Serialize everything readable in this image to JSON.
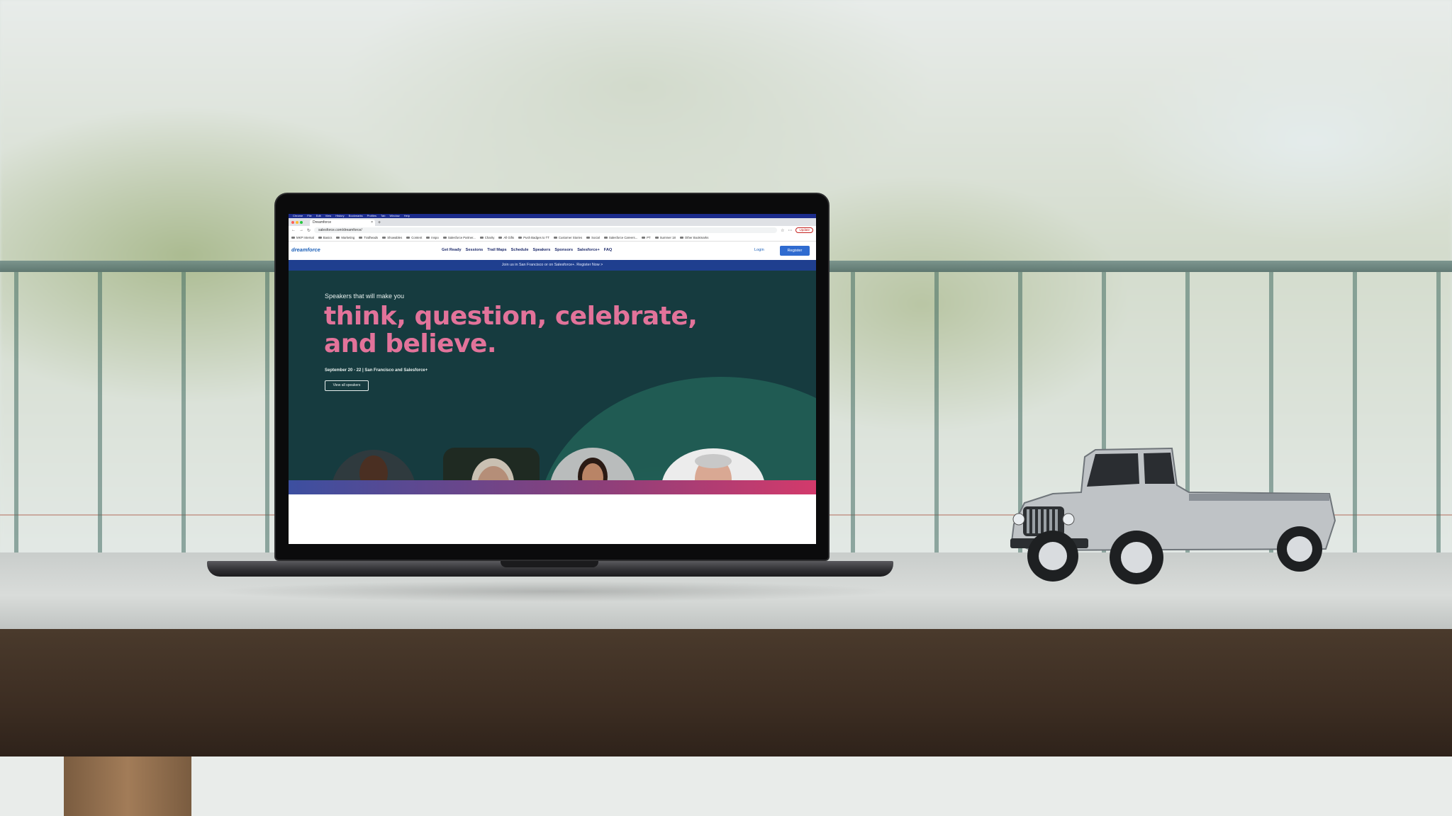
{
  "menubar": {
    "items": [
      "Chrome",
      "File",
      "Edit",
      "View",
      "History",
      "Bookmarks",
      "Profiles",
      "Tab",
      "Window",
      "Help"
    ]
  },
  "browser": {
    "tab_title": "Dreamforce",
    "tab_close": "×",
    "new_tab": "+",
    "url": "salesforce.com/dreamforce/",
    "update_label": "Update",
    "bookmarks": [
      "MKP Internal",
      "Basics",
      "Marketing",
      "Trailheads",
      "Showables",
      "Content",
      "Inspo",
      "Salesforce Partner...",
      "Charity",
      "All Gifts",
      "Push Badges to TT",
      "Customer Stories",
      "Social",
      "Salesforce Careers...",
      "PT",
      "Summer 18",
      "Other Bookmarks"
    ]
  },
  "site": {
    "logo": "dreamforce",
    "nav": [
      "Get Ready",
      "Sessions",
      "Trail Maps",
      "Schedule",
      "Speakers",
      "Sponsors",
      "Salesforce+",
      "FAQ"
    ],
    "login": "Login",
    "register": "Register",
    "banner": "Join us in San Francisco or on Salesforce+.   Register Now >"
  },
  "hero": {
    "subtitle": "Speakers that will make you",
    "title": "think, question, celebrate, and believe.",
    "date": "September 20 - 22  |  San Francisco and Salesforce+",
    "cta": "View all speakers"
  },
  "colors": {
    "hero_bg": "#173f44",
    "accent_pink": "#e2739a",
    "banner_blue": "#1f3f8f",
    "register_blue": "#2f6bd0"
  }
}
